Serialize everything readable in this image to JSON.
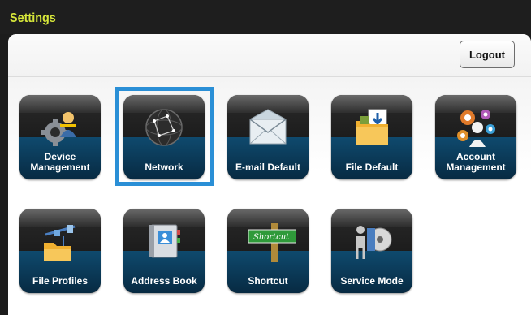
{
  "window": {
    "title": "Settings"
  },
  "header": {
    "logout_label": "Logout"
  },
  "tiles": [
    {
      "label": "Device Management",
      "icon": "device-management-icon"
    },
    {
      "label": "Network",
      "icon": "network-globe-icon",
      "selected": true
    },
    {
      "label": "E-mail Default",
      "icon": "email-envelope-icon"
    },
    {
      "label": "File Default",
      "icon": "file-folder-icon"
    },
    {
      "label": "Account Management",
      "icon": "account-management-icon"
    },
    {
      "label": "File Profiles",
      "icon": "file-profiles-icon"
    },
    {
      "label": "Address Book",
      "icon": "address-book-icon"
    },
    {
      "label": "Shortcut",
      "icon": "shortcut-sign-icon",
      "icon_text": "Shortcut"
    },
    {
      "label": "Service Mode",
      "icon": "service-mode-icon"
    }
  ],
  "colors": {
    "title": "#d6e63a",
    "selection": "#2a8fd6",
    "tile_bottom": "#0b3a58"
  }
}
